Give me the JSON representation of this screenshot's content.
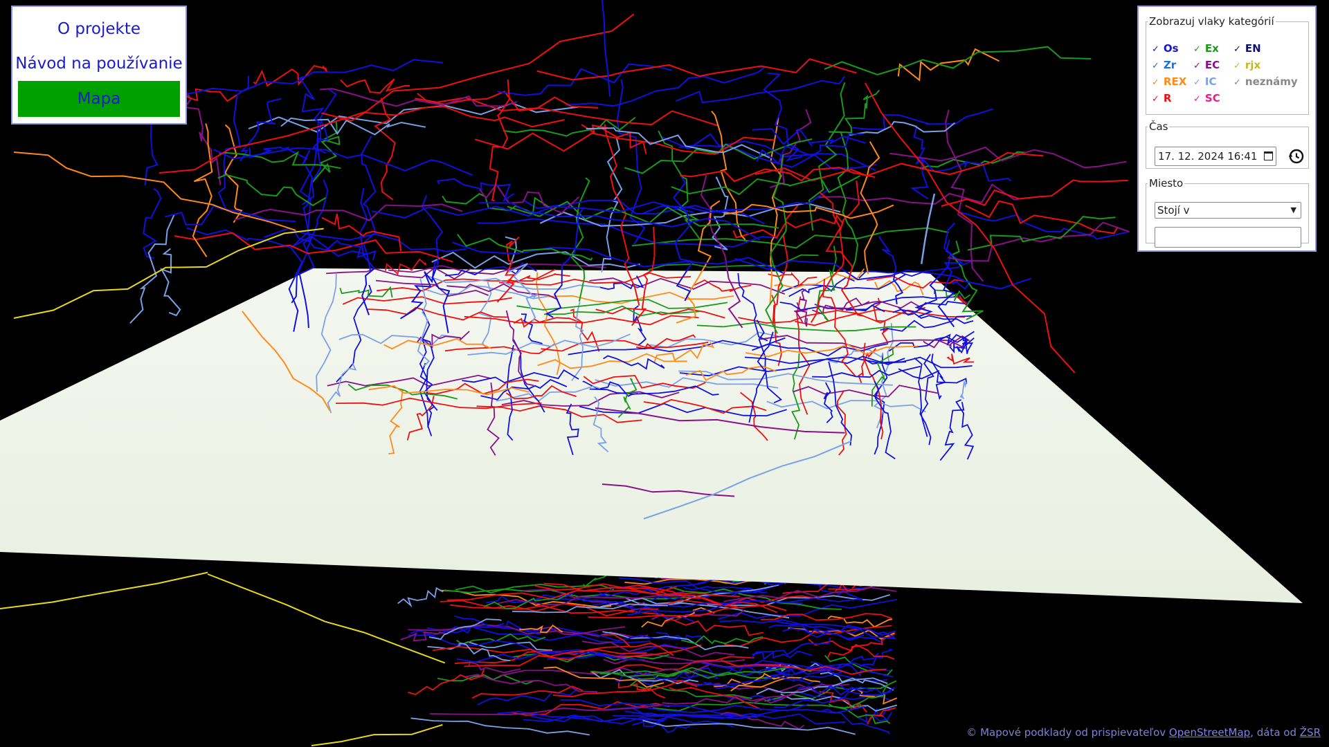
{
  "nav": {
    "about": "O projekte",
    "guide": "Návod na používanie",
    "map": "Mapa"
  },
  "filters": {
    "legend": "Zobrazuj vlaky kategórií",
    "categories": [
      {
        "label": "Os",
        "color": "#1515d0"
      },
      {
        "label": "Ex",
        "color": "#1a9a1a"
      },
      {
        "label": "EN",
        "color": "#10106a"
      },
      {
        "label": "Zr",
        "color": "#1a70e8"
      },
      {
        "label": "EC",
        "color": "#8a108a"
      },
      {
        "label": "rjx",
        "color": "#c8b820"
      },
      {
        "label": "REX",
        "color": "#ff8a1a"
      },
      {
        "label": "IC",
        "color": "#7aa0e8"
      },
      {
        "label": "neznámy",
        "color": "#888888"
      },
      {
        "label": "R",
        "color": "#ee1010"
      },
      {
        "label": "SC",
        "color": "#ee1a8a"
      }
    ]
  },
  "time": {
    "legend": "Čas",
    "value": "17. 12. 2024 16:41"
  },
  "place": {
    "legend": "Miesto",
    "mode": "Stojí v",
    "query": ""
  },
  "attribution": {
    "prefix": "© Mapové podklady od prispievateľov ",
    "osm": "OpenStreetMap",
    "middle": ", dáta od ",
    "zsr": "ŽSR"
  },
  "colors": {
    "panel_border": "#8f95e8",
    "map_active": "#00a000",
    "link": "#1a1ad0"
  }
}
